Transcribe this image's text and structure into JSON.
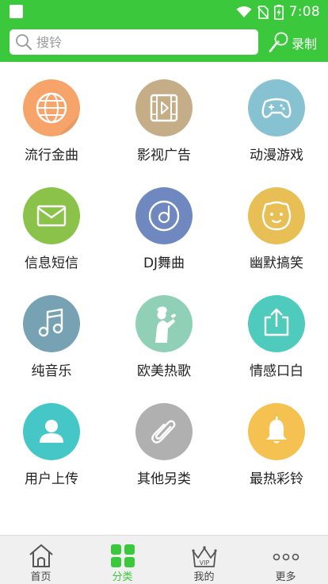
{
  "status_bar": {
    "time": "7:08"
  },
  "search": {
    "placeholder": "搜铃",
    "value": "",
    "record_label": "录制"
  },
  "categories": [
    {
      "label": "流行金曲",
      "icon": "globe-icon",
      "color": "#f7a46a"
    },
    {
      "label": "影视广告",
      "icon": "film-play-icon",
      "color": "#c5ae87"
    },
    {
      "label": "动漫游戏",
      "icon": "gamepad-icon",
      "color": "#87c2d3"
    },
    {
      "label": "信息短信",
      "icon": "envelope-icon",
      "color": "#8bc34a"
    },
    {
      "label": "DJ舞曲",
      "icon": "disc-icon",
      "color": "#6f88bf"
    },
    {
      "label": "幽默搞笑",
      "icon": "smiley-icon",
      "color": "#e7bf55"
    },
    {
      "label": "纯音乐",
      "icon": "music-note-icon",
      "color": "#76a2b4"
    },
    {
      "label": "欧美热歌",
      "icon": "singer-icon",
      "color": "#90d0b7"
    },
    {
      "label": "情感口白",
      "icon": "share-upload-icon",
      "color": "#4fcbbd"
    },
    {
      "label": "用户上传",
      "icon": "user-icon",
      "color": "#46c7c7"
    },
    {
      "label": "其他另类",
      "icon": "paperclip-icon",
      "color": "#b0b0b0"
    },
    {
      "label": "最热彩铃",
      "icon": "bell-icon",
      "color": "#f5c150"
    }
  ],
  "tabs": [
    {
      "label": "首页",
      "icon": "home-icon",
      "active": false
    },
    {
      "label": "分类",
      "icon": "grid-icon",
      "active": true
    },
    {
      "label": "我的",
      "icon": "vip-crown-icon",
      "active": false
    },
    {
      "label": "更多",
      "icon": "more-dots-icon",
      "active": false
    }
  ],
  "colors": {
    "brand": "#3cc83c",
    "tab_active": "#3cc83c",
    "tab_inactive": "#555555"
  }
}
